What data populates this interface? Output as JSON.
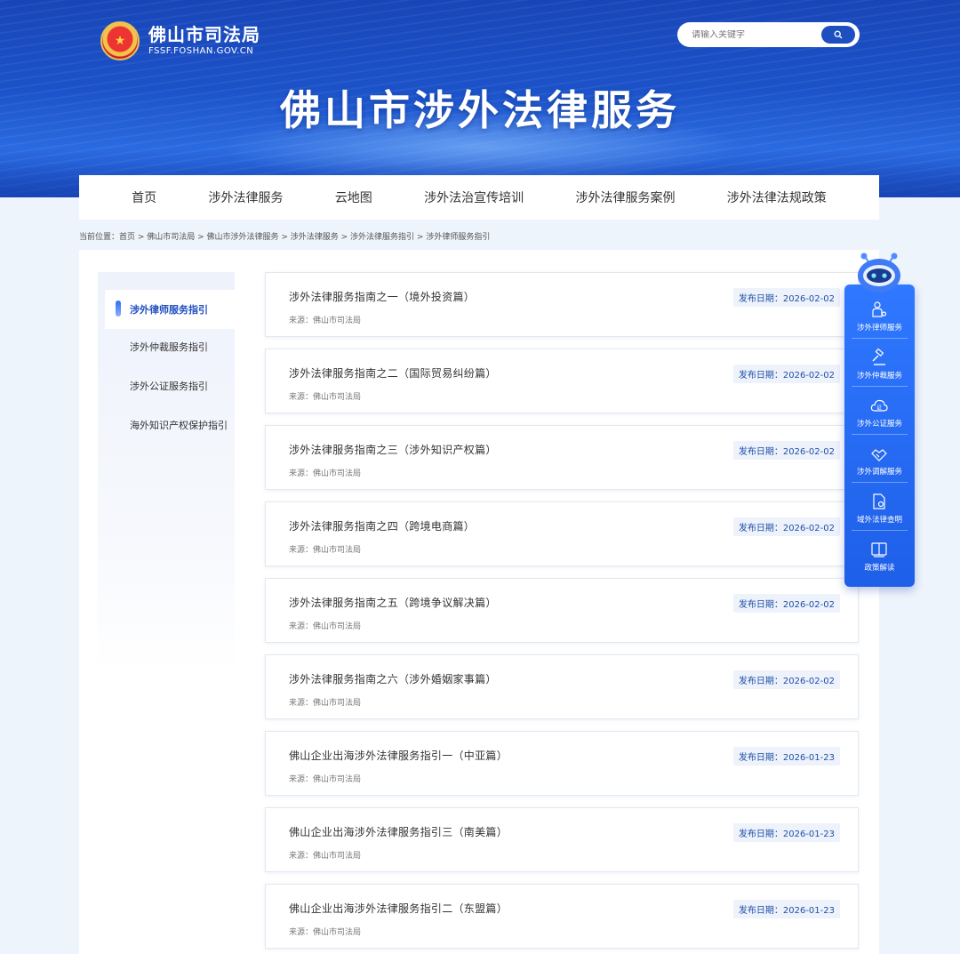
{
  "header": {
    "logo_cn": "佛山市司法局",
    "logo_en": "FSSF.FOSHAN.GOV.CN",
    "emblem_icon": "national-emblem-icon",
    "search_placeholder": "请输入关键字",
    "search_icon": "search-icon",
    "hero_title": "佛山市涉外法律服务"
  },
  "nav": {
    "items": [
      "首页",
      "涉外法律服务",
      "云地图",
      "涉外法治宣传培训",
      "涉外法律服务案例",
      "涉外法律法规政策"
    ]
  },
  "breadcrumb": "当前位置：首页 > 佛山市司法局 > 佛山市涉外法律服务 > 涉外法律服务 > 涉外法律服务指引 > 涉外律师服务指引",
  "sidebar": {
    "items": [
      {
        "label": "涉外律师服务指引",
        "active": true
      },
      {
        "label": "涉外仲裁服务指引",
        "active": false
      },
      {
        "label": "涉外公证服务指引",
        "active": false
      },
      {
        "label": "海外知识产权保护指引",
        "active": false
      }
    ]
  },
  "articles": [
    {
      "title": "涉外法律服务指南之一（境外投资篇）",
      "source": "来源：佛山市司法局",
      "date": "发布日期：2026-02-02"
    },
    {
      "title": "涉外法律服务指南之二（国际贸易纠纷篇）",
      "source": "来源：佛山市司法局",
      "date": "发布日期：2026-02-02"
    },
    {
      "title": "涉外法律服务指南之三（涉外知识产权篇）",
      "source": "来源：佛山市司法局",
      "date": "发布日期：2026-02-02"
    },
    {
      "title": "涉外法律服务指南之四（跨境电商篇）",
      "source": "来源：佛山市司法局",
      "date": "发布日期：2026-02-02"
    },
    {
      "title": "涉外法律服务指南之五（跨境争议解决篇）",
      "source": "来源：佛山市司法局",
      "date": "发布日期：2026-02-02"
    },
    {
      "title": "涉外法律服务指南之六（涉外婚姻家事篇）",
      "source": "来源：佛山市司法局",
      "date": "发布日期：2026-02-02"
    },
    {
      "title": "佛山企业出海涉外法律服务指引一（中亚篇）",
      "source": "来源：佛山市司法局",
      "date": "发布日期：2026-01-23"
    },
    {
      "title": "佛山企业出海涉外法律服务指引三（南美篇）",
      "source": "来源：佛山市司法局",
      "date": "发布日期：2026-01-23"
    },
    {
      "title": "佛山企业出海涉外法律服务指引二（东盟篇）",
      "source": "来源：佛山市司法局",
      "date": "发布日期：2026-01-23"
    }
  ],
  "float_panel": {
    "robot_icon": "robot-assistant-icon",
    "items": [
      {
        "label": "涉外律师服务",
        "icon": "lawyer-icon"
      },
      {
        "label": "涉外仲裁服务",
        "icon": "gavel-icon"
      },
      {
        "label": "涉外公证服务",
        "icon": "notary-cloud-icon"
      },
      {
        "label": "涉外调解服务",
        "icon": "handshake-icon"
      },
      {
        "label": "域外法律查明",
        "icon": "document-search-icon"
      },
      {
        "label": "政策解读",
        "icon": "book-icon"
      }
    ]
  },
  "colors": {
    "banner_blue": "#1c52c9",
    "accent_blue": "#1f4fc1",
    "panel_blue": "#2f78ff",
    "date_text": "#1d4fa8"
  }
}
